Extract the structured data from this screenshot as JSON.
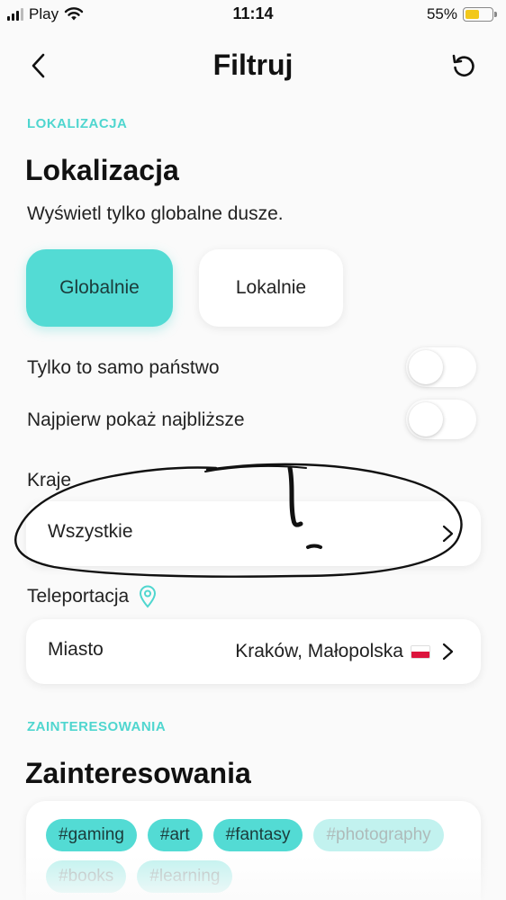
{
  "status_bar": {
    "carrier": "Play",
    "time": "11:14",
    "battery_percent": "55%",
    "battery_level": 0.55,
    "battery_color": "#f2c81b",
    "wifi_icon": "wifi-icon",
    "signal_icon": "cellular-signal-icon"
  },
  "nav": {
    "title": "Filtruj",
    "back_icon": "chevron-left-icon",
    "reset_icon": "reset-icon"
  },
  "location": {
    "section_tag": "LOKALIZACJA",
    "title": "Lokalizacja",
    "description": "Wyświetl tylko globalne dusze.",
    "segments": [
      {
        "label": "Globalnie",
        "selected": true
      },
      {
        "label": "Lokalnie",
        "selected": false
      }
    ],
    "toggles": [
      {
        "label": "Tylko to samo państwo",
        "on": false
      },
      {
        "label": "Najpierw pokaż najbliższe",
        "on": false
      }
    ],
    "countries_label": "Kraje",
    "countries_value": "Wszystkie",
    "teleport_label": "Teleportacja",
    "teleport_icon": "location-pin-icon",
    "city_label": "Miasto",
    "city_value": "Kraków, Małopolska",
    "city_flag": "poland-flag-icon"
  },
  "interests": {
    "section_tag": "ZAINTERESOWANIA",
    "title": "Zainteresowania",
    "chips": [
      "#gaming",
      "#art",
      "#fantasy",
      "#photography",
      "#books",
      "#learning"
    ]
  },
  "colors": {
    "accent": "#53dbd4",
    "tag": "#4fd6cf",
    "background": "#fafafa"
  }
}
